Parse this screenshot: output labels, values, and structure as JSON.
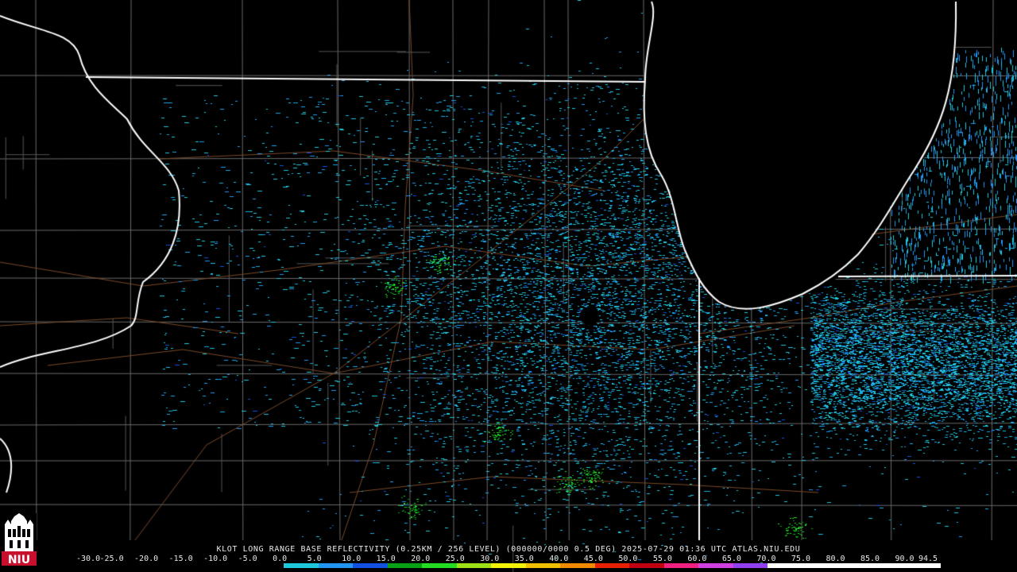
{
  "product_caption": "KLOT LONG RANGE BASE REFLECTIVITY (0.25KM / 256 LEVEL) (000000/0000 0.5 DEG) 2025-07-29 01:36 UTC  ATLAS.NIU.EDU",
  "color_scale": {
    "labels": [
      "-30.0",
      "-25.0",
      "-20.0",
      "-15.0",
      "-10.0",
      "-5.0",
      "0.0",
      "5.0",
      "10.0",
      "15.0",
      "20.0",
      "25.0",
      "30.0",
      "35.0",
      "40.0",
      "45.0",
      "50.0",
      "55.0",
      "60.0",
      "65.0",
      "70.0",
      "75.0",
      "80.0",
      "85.0",
      "90.0",
      "94.5"
    ],
    "colors": [
      "#000000",
      "#000000",
      "#000000",
      "#000000",
      "#000000",
      "#000000",
      "#1ec8dc",
      "#2196f3",
      "#1250e0",
      "#06a014",
      "#22dd22",
      "#9ee016",
      "#f2f20a",
      "#f0c000",
      "#f08a00",
      "#e82000",
      "#c00010",
      "#f02080",
      "#d040e0",
      "#9040f0",
      "#ffffff",
      "#ffffff",
      "#ffffff",
      "#ffffff",
      "#ffffff"
    ]
  },
  "logo_text": "NIU",
  "map": {
    "background": "#000000",
    "county_line_color": "#6a6a6a",
    "state_line_color": "#ffffff",
    "road_color": "#7a4a2a",
    "echo_colors": [
      "#1ec8dc",
      "#18a8e8",
      "#2196f3",
      "#1250e0",
      "#26dd26",
      "#06a014"
    ]
  }
}
